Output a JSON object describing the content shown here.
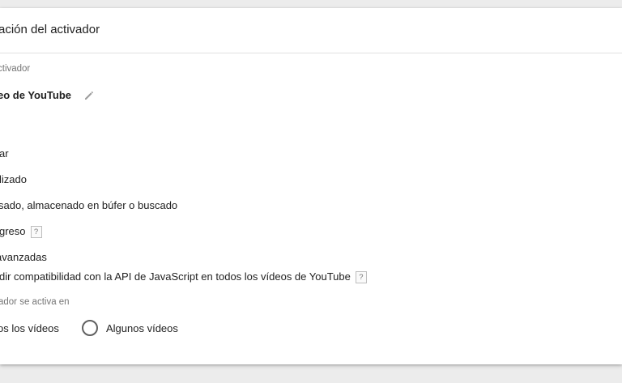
{
  "header": {
    "title": "ración del activador"
  },
  "trigger_type": {
    "label": "ctivador",
    "name": "eo de YouTube",
    "edit_icon": "pencil-icon"
  },
  "capture": {
    "items": [
      {
        "label": "ar"
      },
      {
        "label": "lizado"
      },
      {
        "label": "sado, almacenado en búfer o buscado"
      },
      {
        "label": "greso",
        "help": "?"
      }
    ]
  },
  "advanced": {
    "label": " avanzadas",
    "api_option": {
      "label": "dir compatibilidad con la API de JavaScript en todos los vídeos de YouTube",
      "help": "?"
    }
  },
  "fires_on": {
    "label": "ador se activa en",
    "options": [
      {
        "label": "os los vídeos"
      },
      {
        "label": "Algunos vídeos"
      }
    ]
  },
  "colors": {
    "page_bg": "#ececec",
    "panel_bg": "#ffffff",
    "secondary_text": "#757575",
    "radio_border": "#616161"
  }
}
